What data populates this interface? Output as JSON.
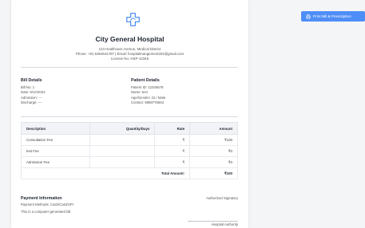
{
  "hospital": {
    "name": "City General Hospital",
    "address": "123 Healthcare Avenue, Medical District",
    "contact_line": "Phone: +91 6364541787 | Email: hospitalmangement204@gmail.com",
    "license": "License No: HSP-12345"
  },
  "bill_details": {
    "title": "Bill Details",
    "bill_no": "Bill No: 1",
    "date": "Date: 6/12/2024",
    "admission": "Admission: ---",
    "discharge": "Discharge: ---"
  },
  "patient_details": {
    "title": "Patient Details",
    "patient_id": "Patient ID: 12345678",
    "name": "Name: test",
    "age_gender": "Age/Gender: 22 / Male",
    "contact": "Contact: 9868776654"
  },
  "table": {
    "headers": [
      "Description",
      "Quantity/Days",
      "Rate",
      "Amount"
    ],
    "rows": [
      [
        "Consultation Fee",
        "",
        "₹",
        "₹100"
      ],
      [
        "test Fee",
        "",
        "₹",
        "₹0"
      ],
      [
        "Admission Fee",
        "",
        "₹",
        "₹0"
      ]
    ],
    "total_label": "Total Amount:",
    "total_value": "₹100"
  },
  "payment": {
    "title": "Payment Information",
    "methods": "Payment Methods: Cash/Card/UPI",
    "note": "This is a computer-generated bill"
  },
  "signatory": {
    "label": "Authorized Signatory",
    "caption": "Hospital Authority"
  },
  "print_button": {
    "label": "Print Bill & Prescription",
    "icon": "printer-icon"
  },
  "colors": {
    "accent": "#4f8ef7",
    "logo": "#3d86f0"
  }
}
